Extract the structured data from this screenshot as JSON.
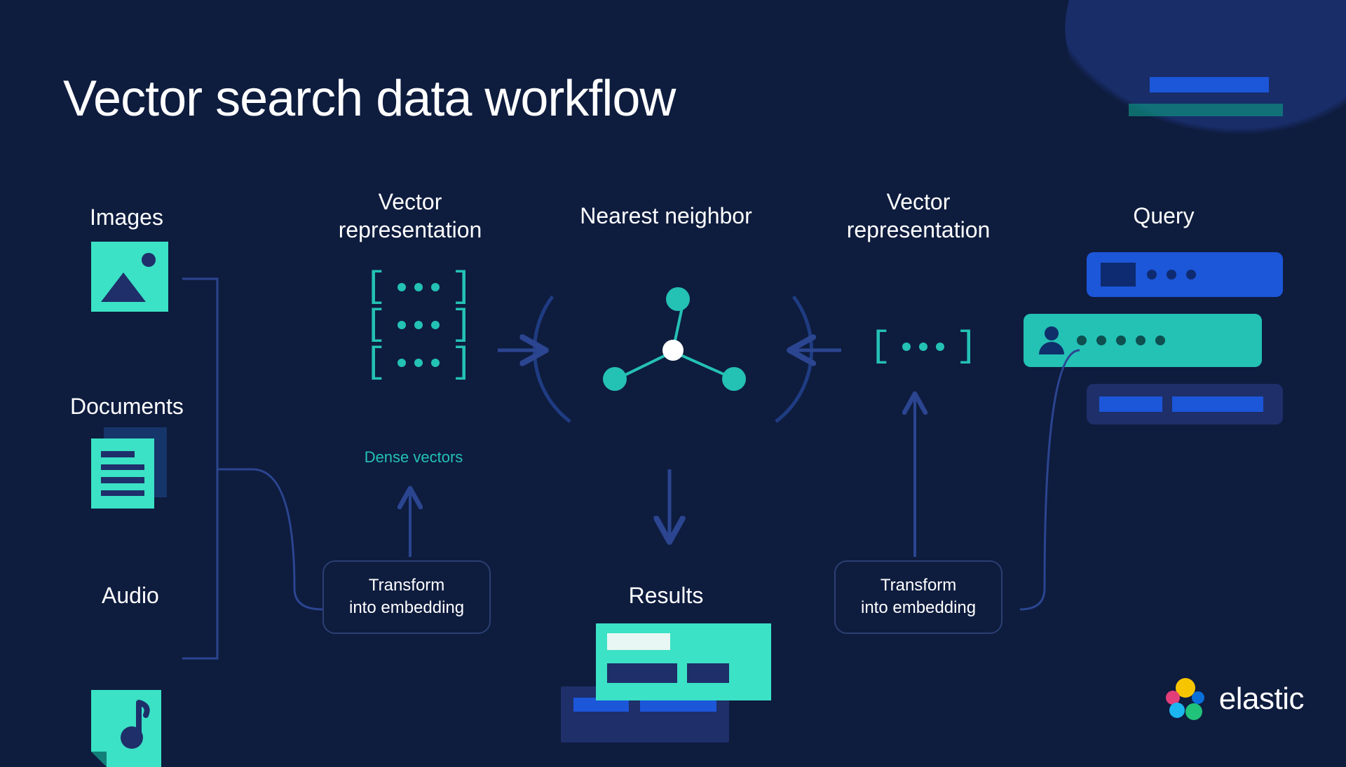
{
  "title": "Vector search data workflow",
  "inputs": {
    "images_label": "Images",
    "documents_label": "Documents",
    "audio_label": "Audio"
  },
  "stages": {
    "vector_rep_left": "Vector\nrepresentation",
    "dense_vectors": "Dense vectors",
    "nearest_neighbor": "Nearest neighbor",
    "vector_rep_right": "Vector\nrepresentation",
    "query": "Query",
    "results": "Results"
  },
  "transform": {
    "left": "Transform\ninto embedding",
    "right": "Transform\ninto embedding"
  },
  "logo_text": "elastic",
  "colors": {
    "background": "#0e1c3e",
    "teal": "#3be2c5",
    "teal_dark": "#24c1b5",
    "blue": "#1c56d9",
    "navy": "#1e2f6a",
    "line": "#2b3f72"
  }
}
